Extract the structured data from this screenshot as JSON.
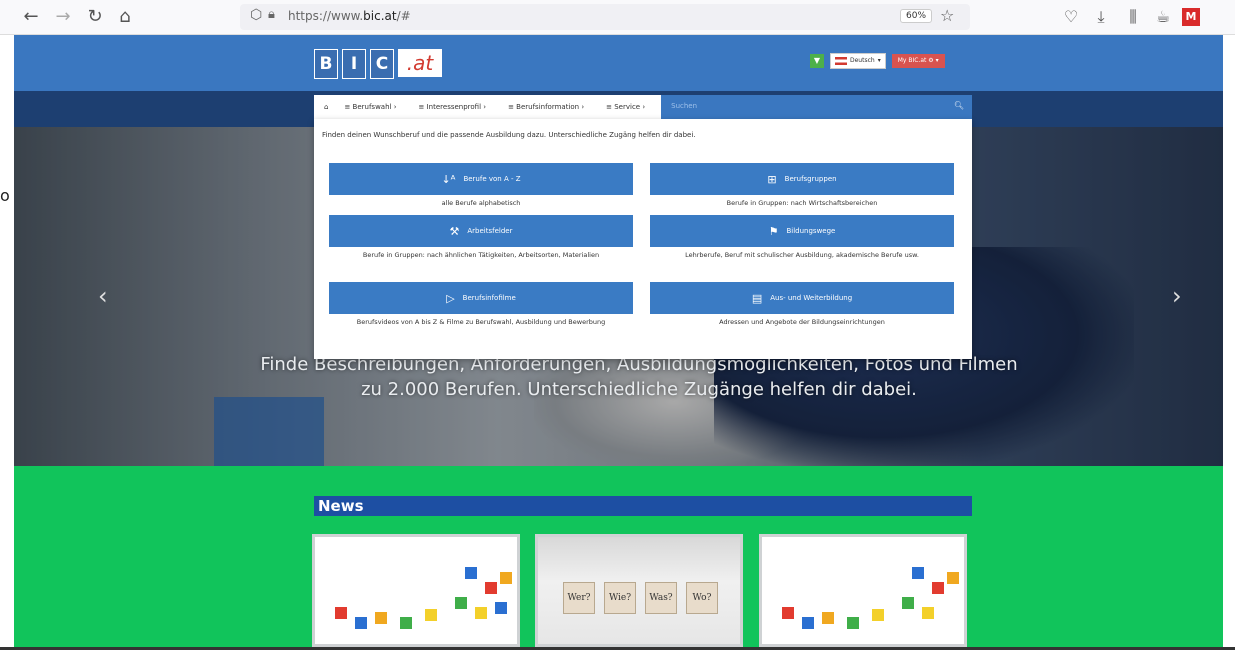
{
  "browser": {
    "url_prefix": "https://www.",
    "url_domain": "bic.at",
    "url_suffix": "/#",
    "zoom": "60%"
  },
  "site": {
    "logo_letters": [
      "B",
      "I",
      "C"
    ],
    "logo_suffix": ".at",
    "lang_label": "Deutsch",
    "mybic_label": "My BIC.at",
    "menu": {
      "home_icon": "home-icon",
      "items": [
        "Berufswahl",
        "Interessenprofil",
        "Berufsinformation",
        "Service"
      ],
      "search_placeholder": "Suchen"
    },
    "dropdown": {
      "intro": "Finden deinen Wunschberuf und die passende Ausbildung dazu. Unterschiedliche Zugäng helfen dir dabei.",
      "entries": [
        {
          "label": "Berufe von A - Z",
          "icon": "az-sort-icon",
          "desc": "alle Berufe alphabetisch"
        },
        {
          "label": "Berufsgruppen",
          "icon": "groups-icon",
          "desc": "Berufe in Gruppen: nach Wirtschaftsbereichen"
        },
        {
          "label": "Arbeitsfelder",
          "icon": "tools-icon",
          "desc": "Berufe in Gruppen: nach ähnlichen Tätigkeiten, Arbeitsorten, Materialien"
        },
        {
          "label": "Bildungswege",
          "icon": "signpost-icon",
          "desc": "Lehrberufe, Beruf mit schulischer Ausbildung, akademische Berufe usw."
        },
        {
          "label": "Berufsinfofilme",
          "icon": "play-icon",
          "desc": "Berufsvideos von A bis Z & Filme zu Berufswahl, Ausbildung und Bewerbung"
        },
        {
          "label": "Aus- und Weiterbildung",
          "icon": "book-icon",
          "desc": "Adressen und Angebote der Bildungseinrichtungen"
        }
      ]
    },
    "hero_text": "Finde Beschreibungen, Anforderungen, Ausbildungsmöglichkeiten, Fotos und Filmen zu 2.000 Berufen. Unterschiedliche Zugänge helfen dir dabei.",
    "news_title": "News",
    "news_cards": [
      {
        "type": "puzzle"
      },
      {
        "type": "dice",
        "words": [
          "Wer?",
          "Wie?",
          "Was?",
          "Wo?"
        ]
      },
      {
        "type": "puzzle"
      }
    ]
  },
  "left_snippet": "o"
}
